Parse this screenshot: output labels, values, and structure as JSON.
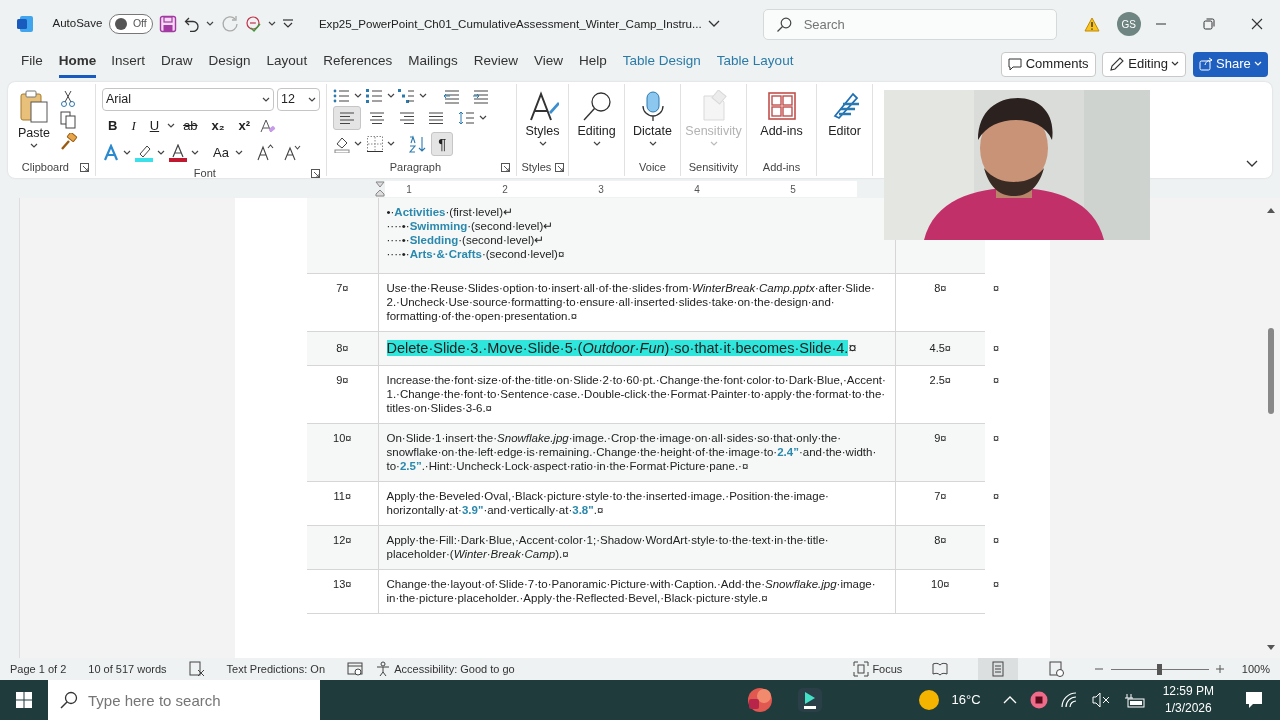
{
  "title_bar": {
    "autosave_label": "AutoSave",
    "autosave": {
      "on": false,
      "label": "Off"
    },
    "document_title": "Exp25_PowerPoint_Ch01_CumulativeAssessment_Winter_Camp_Instru...",
    "search_placeholder": "Search",
    "account_initials": "GS"
  },
  "menu_tabs": [
    {
      "label": "File",
      "selected": false,
      "kind": "normal"
    },
    {
      "label": "Home",
      "selected": true,
      "kind": "normal"
    },
    {
      "label": "Insert",
      "selected": false,
      "kind": "normal"
    },
    {
      "label": "Draw",
      "selected": false,
      "kind": "normal"
    },
    {
      "label": "Design",
      "selected": false,
      "kind": "normal"
    },
    {
      "label": "Layout",
      "selected": false,
      "kind": "normal"
    },
    {
      "label": "References",
      "selected": false,
      "kind": "normal"
    },
    {
      "label": "Mailings",
      "selected": false,
      "kind": "normal"
    },
    {
      "label": "Review",
      "selected": false,
      "kind": "normal"
    },
    {
      "label": "View",
      "selected": false,
      "kind": "normal"
    },
    {
      "label": "Help",
      "selected": false,
      "kind": "normal"
    },
    {
      "label": "Table Design",
      "selected": false,
      "kind": "contextual"
    },
    {
      "label": "Table Layout",
      "selected": false,
      "kind": "contextual"
    }
  ],
  "action_buttons": [
    {
      "label": "Comments",
      "kind": "comments"
    },
    {
      "label": "Editing",
      "kind": "mode"
    },
    {
      "label": "Share",
      "kind": "share"
    }
  ],
  "ribbon": {
    "clipboard": {
      "paste_label": "Paste",
      "group_label": "Clipboard"
    },
    "font": {
      "name": "Arial",
      "size": "12",
      "group_label": "Font",
      "case_label": "Aa",
      "style_buttons": [
        {
          "label": "B",
          "kind": "bold"
        },
        {
          "label": "I",
          "kind": "italic"
        },
        {
          "label": "U",
          "kind": "underline"
        },
        {
          "label": "ab",
          "kind": "strike"
        },
        {
          "label": "x₂",
          "kind": "sub"
        },
        {
          "label": "x²",
          "kind": "sup"
        }
      ]
    },
    "paragraph": {
      "group_label": "Paragraph",
      "alignments": [
        {
          "kind": "left",
          "selected": true
        },
        {
          "kind": "center",
          "selected": false
        },
        {
          "kind": "right",
          "selected": false
        },
        {
          "kind": "justify",
          "selected": false
        }
      ],
      "show_marks": {
        "label": "¶",
        "selected": true
      }
    },
    "big_buttons": [
      {
        "label": "Styles",
        "group_label": "Styles",
        "disabled": false
      },
      {
        "label": "Editing",
        "disabled": false
      },
      {
        "label": "Dictate",
        "group_label": "Voice",
        "disabled": false
      },
      {
        "label": "Sensitivity",
        "group_label": "Sensitivity",
        "disabled": true
      },
      {
        "label": "Add-ins",
        "group_label": "Add-ins",
        "disabled": false
      },
      {
        "label": "Editor",
        "disabled": false
      }
    ]
  },
  "ruler_numbers": [
    "1",
    "2",
    "3",
    "4",
    "5"
  ],
  "table": {
    "rows": [
      {
        "kind": "list",
        "number": "",
        "lines": [
          "•·**Activities**·(first·level)↵",
          "····•·**Swimming**·(second·level)↵",
          "····•·**Sledding**·(second·level)↵",
          "····•·**Arts·&·Crafts**·(second·level)¤"
        ],
        "points": "",
        "end_mark": ""
      },
      {
        "kind": "text",
        "number": "7¤",
        "instruction": "Use·the·Reuse·Slides·option·to·insert·all·of·the·slides·from·*WinterBreak·Camp.pptx*·after·Slide·2.·Uncheck·Use·source·formatting·to·ensure·all·inserted·slides·take·on·the·design·and·formatting·of·the·open·presentation.",
        "cell_mark": "¤",
        "highlighted": false,
        "points": "8¤",
        "end_mark": "¤"
      },
      {
        "kind": "text",
        "number": "8¤",
        "instruction": "Delete·Slide·3.·Move·Slide·5·(*Outdoor·Fun*)·so·that·it·becomes·Slide·4.",
        "cell_mark": "¤",
        "highlighted": true,
        "points": "4.5¤",
        "end_mark": "¤"
      },
      {
        "kind": "text",
        "number": "9¤",
        "instruction": "Increase·the·font·size·of·the·title·on·Slide·2·to·60·pt.·Change·the·font·color·to·Dark·Blue,·Accent·1.·Change·the·font·to·Sentence·case.·Double-click·the·Format·Painter·to·apply·the·format·to·the·titles·on·Slides·3-6.",
        "cell_mark": "¤",
        "highlighted": false,
        "points": "2.5¤",
        "end_mark": "¤"
      },
      {
        "kind": "text",
        "number": "10¤",
        "instruction": "On·Slide·1·insert·the·*Snowflake.jpg*·image.·Crop·the·image·on·all·sides·so·that·only·the·snowflake·on·the·left·edge·is·remaining.·Change·the·height·of·the·image·to·**2.4”**·and·the·width·to·**2.5”**.·Hint:·Uncheck·Lock·aspect·ratio·in·the·Format·Picture·pane.·",
        "cell_mark": "¤",
        "highlighted": false,
        "points": "9¤",
        "end_mark": "¤"
      },
      {
        "kind": "text",
        "number": "11¤",
        "instruction": "Apply·the·Beveled·Oval,·Black·picture·style·to·the·inserted·image.·Position·the·image·horizontally·at·**3.9\"**·and·vertically·at·**3.8\"**.",
        "cell_mark": "¤",
        "highlighted": false,
        "points": "7¤",
        "end_mark": "¤"
      },
      {
        "kind": "text",
        "number": "12¤",
        "instruction": "Apply·the·Fill:·Dark·Blue,·Accent·color·1;·Shadow·WordArt·style·to·the·text·in·the·title·placeholder·(*Winter·Break·Camp*).",
        "cell_mark": "¤",
        "highlighted": false,
        "points": "8¤",
        "end_mark": "¤"
      },
      {
        "kind": "text",
        "number": "13¤",
        "instruction": "Change·the·layout·of·Slide·7·to·Panoramic·Picture·with·Caption.·Add·the·*Snowflake.jpg*·image·in·the·picture·placeholder.·Apply·the·Reflected·Bevel,·Black·picture·style.",
        "cell_mark": "¤",
        "highlighted": false,
        "points": "10¤",
        "end_mark": "¤"
      }
    ]
  },
  "webcam": {
    "kind": "picture"
  },
  "status_bar": {
    "page": "Page 1 of 2",
    "words": "10 of 517 words",
    "text_predictions": "Text Predictions: On",
    "accessibility": "Accessibility: Good to go",
    "focus_label": "Focus",
    "views": [
      {
        "kind": "read",
        "selected": false
      },
      {
        "kind": "print",
        "selected": true
      },
      {
        "kind": "web",
        "selected": false
      }
    ],
    "zoom": {
      "level": 0.49,
      "label": "100%"
    }
  },
  "taskbar": {
    "search_placeholder": "Type here to search",
    "weather": "16°C",
    "time": "12:59 PM",
    "date": "1/3/2026"
  }
}
